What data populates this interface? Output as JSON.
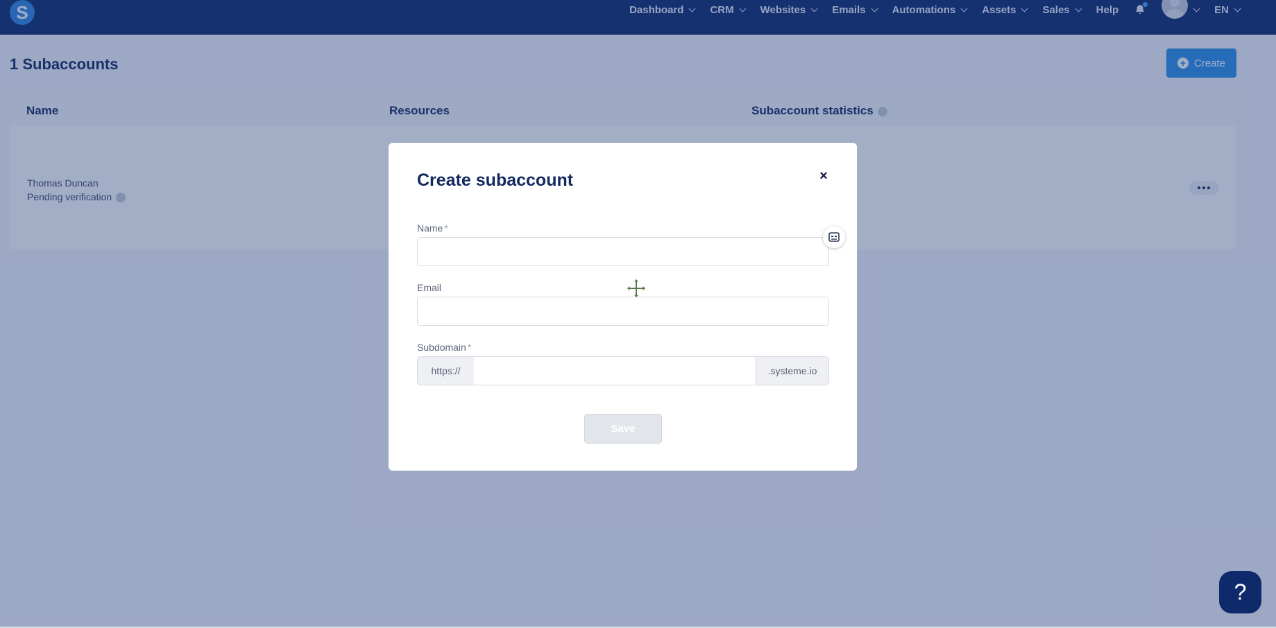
{
  "brand": {
    "logo_letter": "S"
  },
  "nav": {
    "items": [
      {
        "label": "Dashboard"
      },
      {
        "label": "CRM"
      },
      {
        "label": "Websites"
      },
      {
        "label": "Emails"
      },
      {
        "label": "Automations"
      },
      {
        "label": "Assets"
      },
      {
        "label": "Sales"
      }
    ],
    "help_label": "Help",
    "language": "EN"
  },
  "page": {
    "title": "1 Subaccounts",
    "create_label": "Create",
    "table": {
      "columns": [
        "Name",
        "Resources",
        "Subaccount statistics"
      ],
      "rows": [
        {
          "name": "Thomas Duncan",
          "status": "Pending verification"
        }
      ]
    }
  },
  "modal": {
    "title": "Create subaccount",
    "close_glyph": "×",
    "fields": {
      "name_label": "Name",
      "email_label": "Email",
      "subdomain_label": "Subdomain",
      "required_mark": "*",
      "prefix": "https://",
      "suffix": ".systeme.io",
      "name_value": "",
      "email_value": "",
      "subdomain_value": ""
    },
    "save_label": "Save"
  },
  "help": {
    "glyph": "?"
  },
  "colors": {
    "nav_bg": "#0f2a6b",
    "accent": "#2a8fe8",
    "title_text": "#14295f"
  }
}
